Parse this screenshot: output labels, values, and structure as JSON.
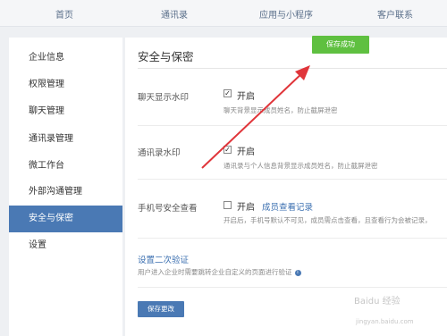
{
  "topnav": {
    "items": [
      "首页",
      "通讯录",
      "应用与小程序",
      "客户联系"
    ]
  },
  "sidebar": {
    "items": [
      "企业信息",
      "权限管理",
      "聊天管理",
      "通讯录管理",
      "微工作台",
      "外部沟通管理",
      "安全与保密",
      "设置"
    ],
    "active": "安全与保密"
  },
  "main": {
    "title": "安全与保密",
    "toast": "保存成功",
    "chat_watermark": {
      "label": "聊天显示水印",
      "checkbox_label": "开启",
      "checked": true,
      "hint": "聊天背景显示成员姓名，防止截屏泄密"
    },
    "contacts_watermark": {
      "label": "通讯录水印",
      "checkbox_label": "开启",
      "checked": true,
      "hint": "通讯录与个人信息背景显示成员姓名，防止截屏泄密"
    },
    "phone_security": {
      "label": "手机号安全查看",
      "checkbox_label": "开启",
      "checked": false,
      "link": "成员查看记录",
      "hint": "开启后，手机号默认不可见，成员需点击查看，且查看行为会被记录，"
    },
    "second_verify": {
      "link": "设置二次验证",
      "hint": "用户进入企业时需要跳转企业自定义的页面进行验证"
    },
    "save_button": "保存更改"
  },
  "watermark_text": "Baidu 经验",
  "watermark_sub": "jingyan.baidu.com",
  "colors": {
    "accent": "#4a79b4",
    "toast": "#5fc040",
    "arrow": "#e0353a",
    "link": "#3b6fb0"
  },
  "icons": [
    "checkbox-checked-icon",
    "checkbox-unchecked-icon",
    "info-icon",
    "red-arrow-annotation"
  ]
}
